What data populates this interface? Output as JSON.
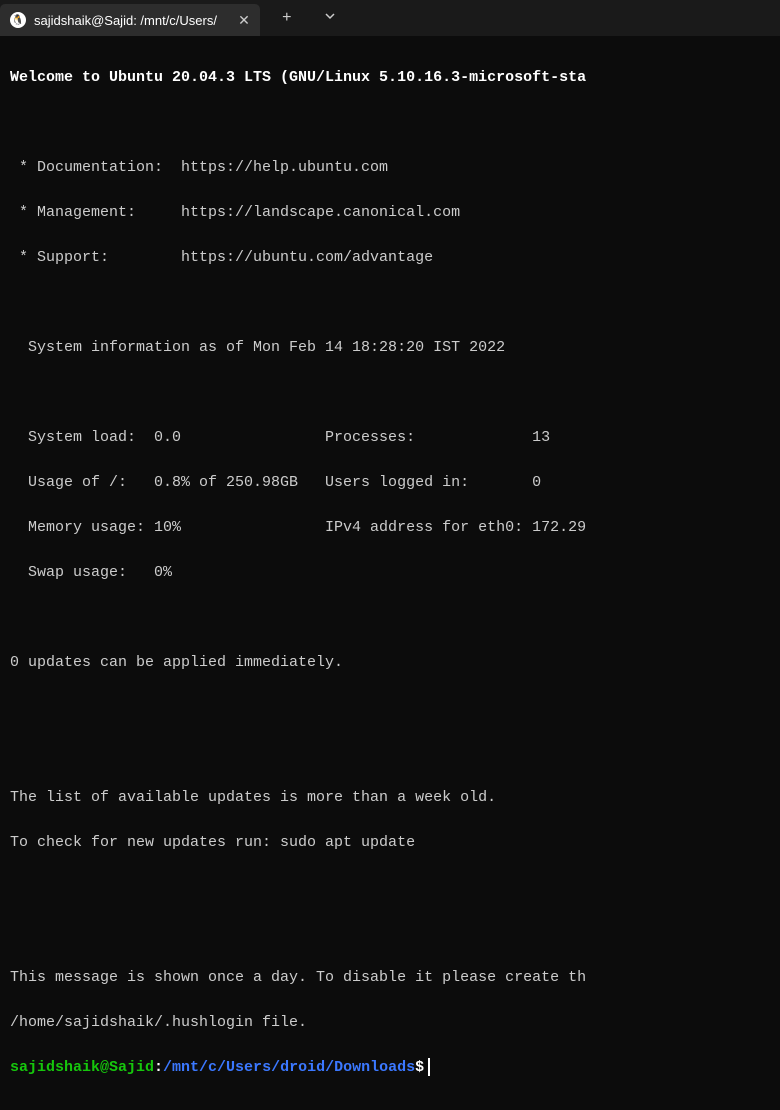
{
  "titlebar": {
    "tab_label": "sajidshaik@Sajid: /mnt/c/Users/",
    "tab_icon": "🐧"
  },
  "motd": {
    "welcome": "Welcome to Ubuntu 20.04.3 LTS (GNU/Linux 5.10.16.3-microsoft-sta",
    "doc_label": " * Documentation:  https://help.ubuntu.com",
    "mgmt_label": " * Management:     https://landscape.canonical.com",
    "support_label": " * Support:        https://ubuntu.com/advantage",
    "sysinfo_header": "  System information as of Mon Feb 14 18:28:20 IST 2022",
    "stat_line1": "  System load:  0.0                Processes:             13",
    "stat_line2": "  Usage of /:   0.8% of 250.98GB   Users logged in:       0",
    "stat_line3": "  Memory usage: 10%                IPv4 address for eth0: 172.29",
    "stat_line4": "  Swap usage:   0%",
    "updates": "0 updates can be applied immediately.",
    "stale1": "The list of available updates is more than a week old.",
    "stale2": "To check for new updates run: sudo apt update",
    "hush1": "This message is shown once a day. To disable it please create th",
    "hush2": "/home/sajidshaik/.hushlogin file."
  },
  "prompt": {
    "user": "sajidshaik@Sajid",
    "colon": ":",
    "path": "/mnt/c/Users/droid/Downloads",
    "dollar": "$"
  }
}
